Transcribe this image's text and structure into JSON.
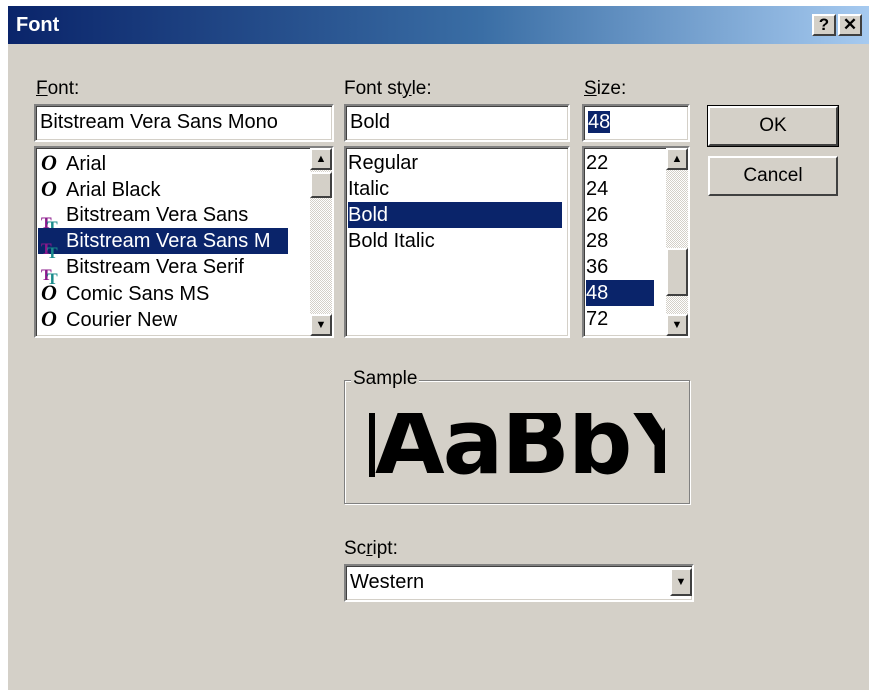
{
  "window": {
    "title": "Font",
    "help_label": "?",
    "close_label": "✕"
  },
  "font": {
    "label_underlined": "F",
    "label_rest": "ont:",
    "value": "Bitstream Vera Sans Mono",
    "items": [
      {
        "label": "Arial",
        "icon": "opentype-icon"
      },
      {
        "label": "Arial Black",
        "icon": "opentype-icon"
      },
      {
        "label": "Bitstream Vera Sans",
        "icon": "truetype-icon"
      },
      {
        "label": "Bitstream Vera Sans M",
        "icon": "truetype-icon"
      },
      {
        "label": "Bitstream Vera Serif",
        "icon": "truetype-icon"
      },
      {
        "label": "Comic Sans MS",
        "icon": "opentype-icon"
      },
      {
        "label": "Courier New",
        "icon": "opentype-icon"
      }
    ],
    "selected_index": 3
  },
  "style": {
    "label_pre": "Font st",
    "label_underlined": "y",
    "label_rest": "le:",
    "value": "Bold",
    "items": [
      "Regular",
      "Italic",
      "Bold",
      "Bold Italic"
    ],
    "selected_index": 2
  },
  "size": {
    "label_underlined": "S",
    "label_rest": "ize:",
    "value": "48",
    "items": [
      "22",
      "24",
      "26",
      "28",
      "36",
      "48",
      "72"
    ],
    "selected_index": 5
  },
  "buttons": {
    "ok": "OK",
    "cancel": "Cancel"
  },
  "sample": {
    "legend": "Sample",
    "text": "AaBbYyZz"
  },
  "script": {
    "label_pre": "Sc",
    "label_underlined": "r",
    "label_rest": "ipt:",
    "value": "Western"
  },
  "icons": {
    "scroll_up": "▲",
    "scroll_down": "▼",
    "dropdown": "▼"
  }
}
